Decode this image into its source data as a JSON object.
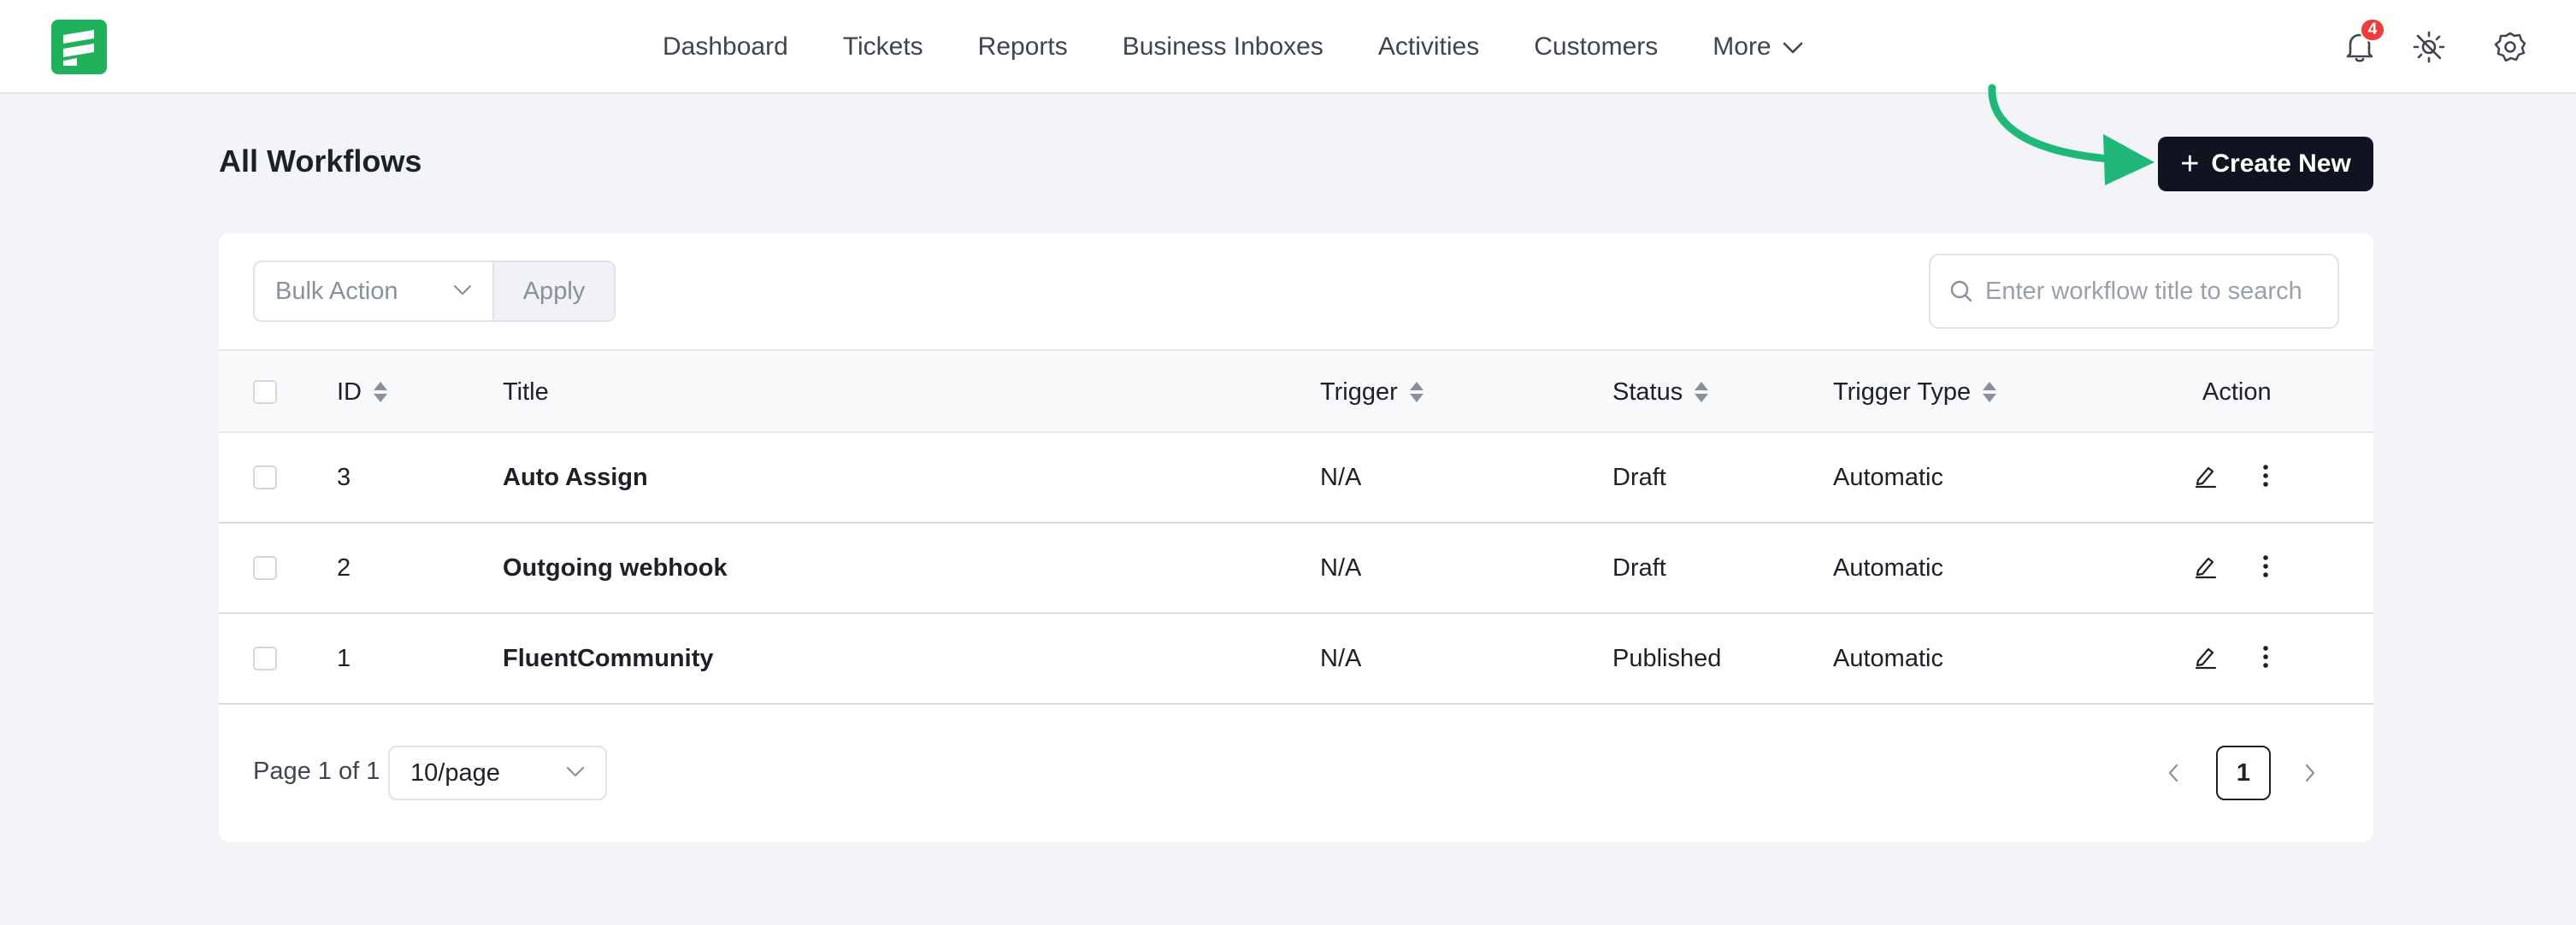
{
  "nav": {
    "items": [
      "Dashboard",
      "Tickets",
      "Reports",
      "Business Inboxes",
      "Activities",
      "Customers"
    ],
    "more_label": "More",
    "notification_count": "4"
  },
  "page": {
    "title": "All Workflows",
    "create_label": "Create New"
  },
  "toolbar": {
    "bulk_action_placeholder": "Bulk Action",
    "apply_label": "Apply",
    "search_placeholder": "Enter workflow title to search"
  },
  "table": {
    "columns": {
      "id": "ID",
      "title": "Title",
      "trigger": "Trigger",
      "status": "Status",
      "trigger_type": "Trigger Type",
      "action": "Action"
    },
    "rows": [
      {
        "id": "3",
        "title": "Auto Assign",
        "trigger": "N/A",
        "status": "Draft",
        "trigger_type": "Automatic"
      },
      {
        "id": "2",
        "title": "Outgoing webhook",
        "trigger": "N/A",
        "status": "Draft",
        "trigger_type": "Automatic"
      },
      {
        "id": "1",
        "title": "FluentCommunity",
        "trigger": "N/A",
        "status": "Published",
        "trigger_type": "Automatic"
      }
    ]
  },
  "pagination": {
    "page_text": "Page 1 of 1",
    "per_page": "10/page",
    "current_page": "1"
  },
  "colors": {
    "brand": "#1fb25a",
    "primary_button": "#0f1420",
    "annotation_arrow": "#1fb878",
    "badge": "#ee3b3b"
  },
  "icons": {
    "logo": "fluent-logo",
    "notifications": "bell-icon",
    "theme": "sun-icon",
    "settings": "gear-icon",
    "edit": "edit-pen-icon",
    "more": "vertical-dots-icon"
  }
}
